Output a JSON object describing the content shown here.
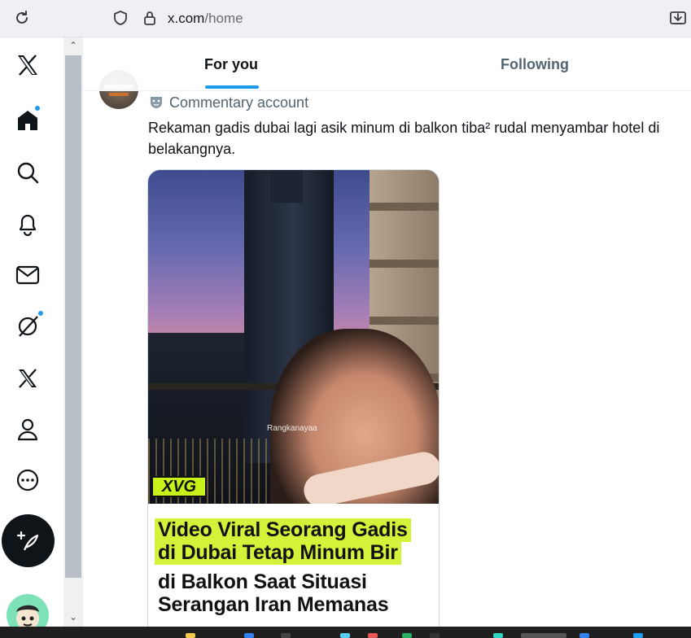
{
  "browser": {
    "url_host": "x.com",
    "url_path": "/home"
  },
  "nav": {
    "items": [
      {
        "name": "x-logo-icon"
      },
      {
        "name": "home-icon"
      },
      {
        "name": "search-icon"
      },
      {
        "name": "notifications-icon"
      },
      {
        "name": "messages-icon"
      },
      {
        "name": "grok-icon"
      },
      {
        "name": "premium-x-icon"
      },
      {
        "name": "profile-icon"
      },
      {
        "name": "more-icon"
      }
    ],
    "accent": "#1d9bf0"
  },
  "tabs": [
    {
      "label": "For you",
      "active": true
    },
    {
      "label": "Following",
      "active": false
    }
  ],
  "post": {
    "account_label": "Commentary account",
    "text": "Rekaman gadis dubai lagi asik minum di balkon tiba² rudal menyambar hotel di belakangnya.",
    "media": {
      "watermark": "Rangkanayaa",
      "badge": "XVG",
      "caption_lines": [
        "Video Viral Seorang Gadis",
        "di Dubai Tetap Minum Bir",
        "di Balkon Saat Situasi",
        "Serangan Iran Memanas"
      ]
    }
  }
}
